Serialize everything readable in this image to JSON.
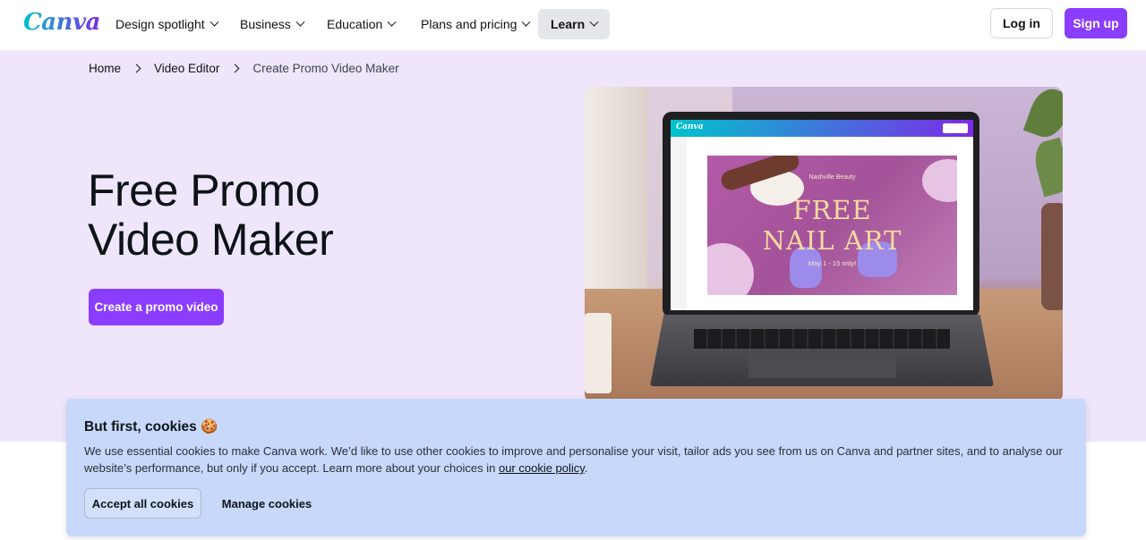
{
  "nav": {
    "logo": "Canva",
    "items": [
      {
        "label": "Design spotlight"
      },
      {
        "label": "Business"
      },
      {
        "label": "Education"
      },
      {
        "label": "Plans and pricing"
      },
      {
        "label": "Learn"
      }
    ],
    "login": "Log in",
    "signup": "Sign up"
  },
  "breadcrumb": [
    "Home",
    "Video Editor",
    "Create Promo Video Maker"
  ],
  "hero": {
    "title_line1": "Free Promo",
    "title_line2": "Video Maker",
    "cta": "Create a promo video",
    "image": {
      "editor_logo": "Canva",
      "design_brand": "Nashville Beauty",
      "design_title_line1": "FREE",
      "design_title_line2": "NAIL ART",
      "design_date": "May 1 - 15 only!"
    }
  },
  "cookie": {
    "title": "But first, cookies",
    "emoji": "🍪",
    "text_before_link": "We use essential cookies to make Canva work. We’d like to use other cookies to improve and personalise your visit, tailor ads you see from us on Canva and partner sites, and to analyse our website’s performance, but only if you accept. Learn more about your choices in ",
    "link": "our cookie policy",
    "text_after_link": ".",
    "accept": "Accept all cookies",
    "manage": "Manage cookies"
  },
  "colors": {
    "brand_purple": "#8b3dff",
    "hero_bg": "#efe6fb",
    "cookie_bg": "#c7d8fa"
  }
}
